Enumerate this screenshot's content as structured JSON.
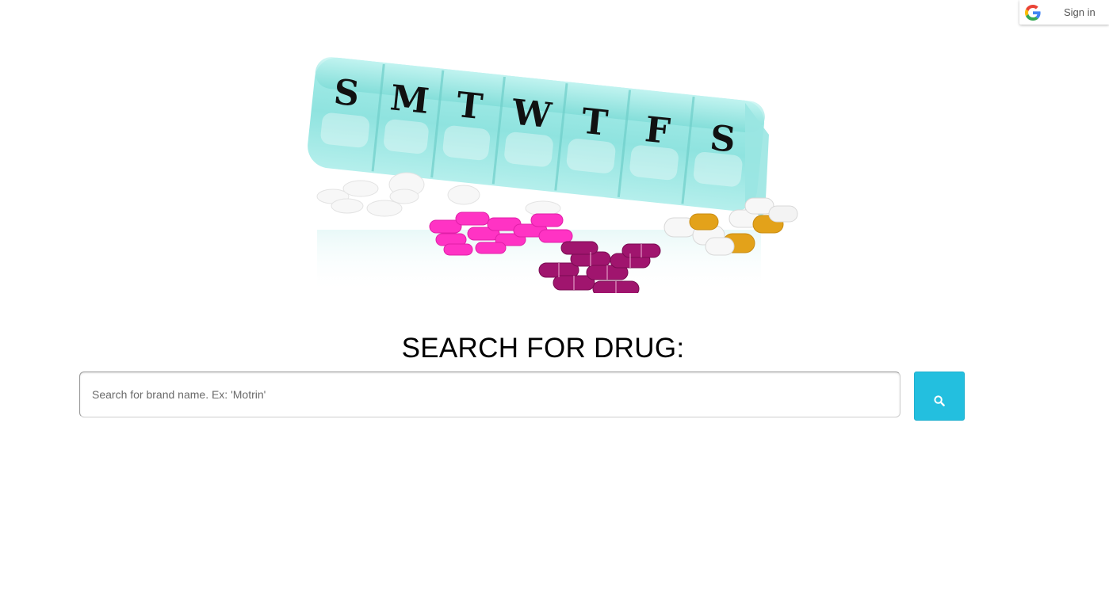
{
  "signin": {
    "label": "Sign in",
    "icon": "google-g-icon"
  },
  "hero": {
    "icon": "pill-organizer-image",
    "day_letters": [
      "S",
      "M",
      "T",
      "W",
      "T",
      "F",
      "S"
    ],
    "colors": {
      "organizer": "#8fe3df",
      "pink_pills": "#ff33c4",
      "purple_capsules": "#a0156e",
      "orange_capsules": "#e3a21a",
      "white_pills": "#f7f7f7"
    }
  },
  "main": {
    "heading": "SEARCH FOR DRUG:",
    "search": {
      "value": "",
      "placeholder": "Search for brand name. Ex: 'Motrin'"
    },
    "search_button": {
      "icon": "search-icon",
      "color": "#23bfdf"
    }
  }
}
